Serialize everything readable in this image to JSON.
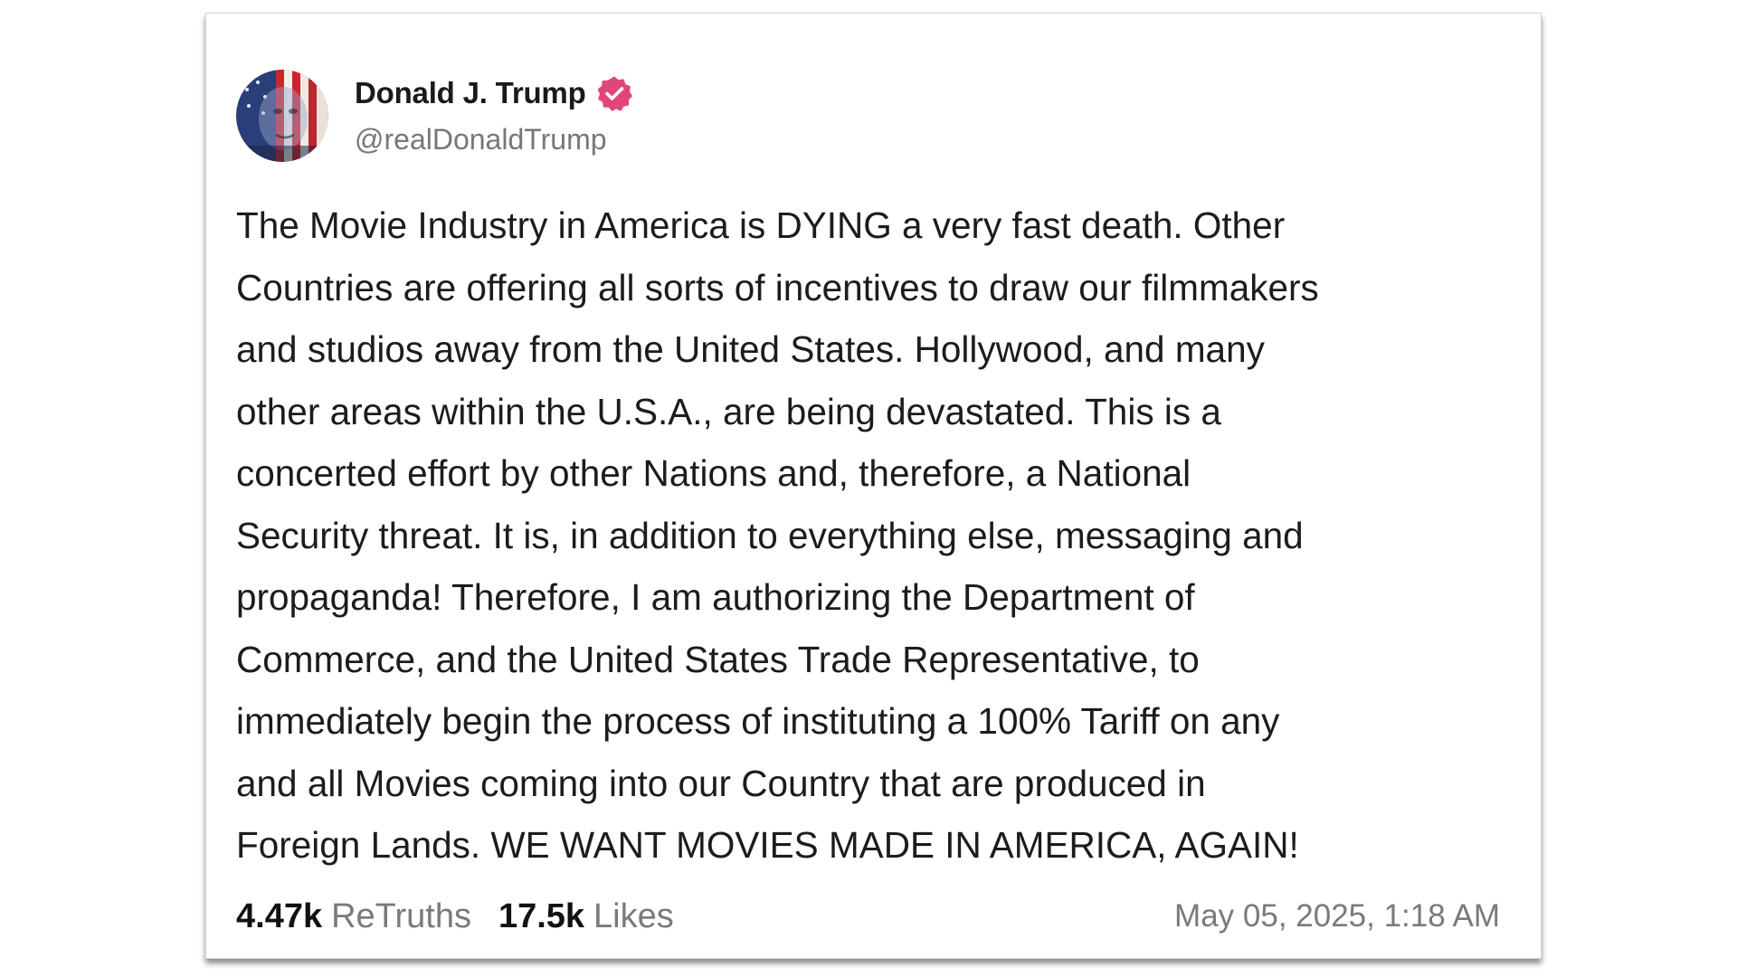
{
  "post": {
    "author": {
      "display_name": "Donald J. Trump",
      "handle": "@realDonaldTrump",
      "verified": true,
      "avatar_icon": "flag-portrait-avatar",
      "verified_icon": "verified-badge-icon",
      "verified_color": "#e0457b"
    },
    "text": "The Movie Industry in America is DYING a very fast death. Other\nCountries are offering all sorts of incentives to draw our filmmakers\nand studios away from the United States. Hollywood, and many\nother areas within the U.S.A., are being devastated. This is a\nconcerted effort by other Nations and, therefore, a National\nSecurity threat. It is, in addition to everything else, messaging and\npropaganda! Therefore, I am authorizing the Department of\nCommerce, and the United States Trade Representative, to\nimmediately begin the process of instituting a 100% Tariff on any\nand all Movies coming into our Country that are produced in\nForeign Lands. WE WANT MOVIES MADE IN AMERICA, AGAIN!",
    "stats": {
      "retruths_value": "4.47k",
      "retruths_label": "ReTruths",
      "likes_value": "17.5k",
      "likes_label": "Likes"
    },
    "timestamp": "May 05, 2025, 1:18 AM"
  }
}
